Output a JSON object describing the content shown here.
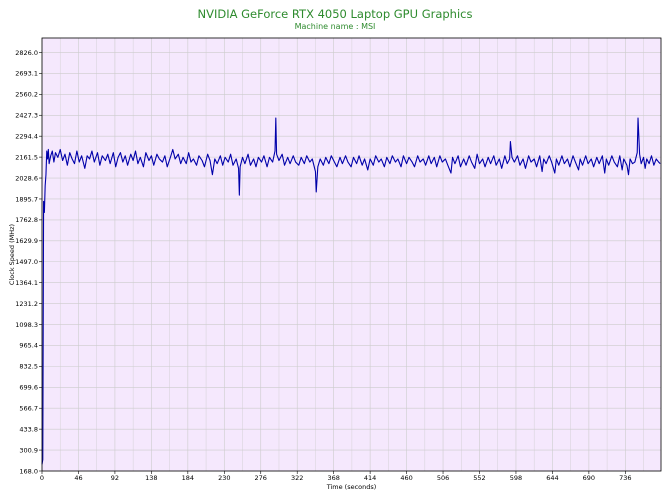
{
  "chart_data": {
    "type": "line",
    "title": "NVIDIA GeForce RTX 4050 Laptop GPU Graphics",
    "subtitle": "Machine name : MSI",
    "xlabel": "Time (seconds)",
    "ylabel": "Clock Speed (MHz)",
    "xlim": [
      0,
      781
    ],
    "ylim": [
      168,
      2918
    ],
    "grid": true,
    "x_ticks": [
      0,
      46,
      92,
      138,
      184,
      230,
      276,
      322,
      368,
      414,
      460,
      506,
      552,
      598,
      644,
      690,
      736
    ],
    "y_ticks": [
      168.0,
      300.9,
      433.8,
      566.7,
      699.6,
      832.5,
      965.4,
      1098.3,
      1231.2,
      1364.1,
      1497.0,
      1629.9,
      1762.8,
      1895.7,
      2028.6,
      2161.5,
      2294.4,
      2427.3,
      2560.2,
      2693.1,
      2826.0
    ],
    "series": [
      {
        "color": "#0000aa",
        "points": [
          [
            0,
            210
          ],
          [
            1,
            240
          ],
          [
            2,
            1880
          ],
          [
            3,
            1810
          ],
          [
            4,
            1980
          ],
          [
            5,
            2050
          ],
          [
            6,
            2200
          ],
          [
            7,
            2150
          ],
          [
            8,
            2210
          ],
          [
            9,
            2120
          ],
          [
            11,
            2170
          ],
          [
            13,
            2200
          ],
          [
            15,
            2130
          ],
          [
            17,
            2190
          ],
          [
            20,
            2160
          ],
          [
            23,
            2210
          ],
          [
            26,
            2140
          ],
          [
            29,
            2180
          ],
          [
            32,
            2110
          ],
          [
            35,
            2190
          ],
          [
            38,
            2150
          ],
          [
            41,
            2120
          ],
          [
            44,
            2200
          ],
          [
            47,
            2130
          ],
          [
            50,
            2170
          ],
          [
            54,
            2090
          ],
          [
            57,
            2170
          ],
          [
            60,
            2150
          ],
          [
            63,
            2200
          ],
          [
            66,
            2130
          ],
          [
            70,
            2190
          ],
          [
            73,
            2110
          ],
          [
            76,
            2170
          ],
          [
            80,
            2140
          ],
          [
            83,
            2180
          ],
          [
            86,
            2120
          ],
          [
            90,
            2190
          ],
          [
            93,
            2100
          ],
          [
            96,
            2160
          ],
          [
            99,
            2190
          ],
          [
            102,
            2130
          ],
          [
            105,
            2170
          ],
          [
            108,
            2110
          ],
          [
            112,
            2180
          ],
          [
            115,
            2140
          ],
          [
            118,
            2200
          ],
          [
            121,
            2120
          ],
          [
            124,
            2160
          ],
          [
            128,
            2100
          ],
          [
            131,
            2190
          ],
          [
            135,
            2140
          ],
          [
            138,
            2170
          ],
          [
            141,
            2110
          ],
          [
            145,
            2180
          ],
          [
            148,
            2150
          ],
          [
            152,
            2130
          ],
          [
            155,
            2170
          ],
          [
            158,
            2100
          ],
          [
            162,
            2160
          ],
          [
            165,
            2210
          ],
          [
            168,
            2150
          ],
          [
            172,
            2180
          ],
          [
            175,
            2120
          ],
          [
            178,
            2160
          ],
          [
            182,
            2120
          ],
          [
            185,
            2190
          ],
          [
            188,
            2130
          ],
          [
            191,
            2150
          ],
          [
            195,
            2110
          ],
          [
            198,
            2170
          ],
          [
            202,
            2140
          ],
          [
            205,
            2100
          ],
          [
            209,
            2180
          ],
          [
            212,
            2140
          ],
          [
            215,
            2050
          ],
          [
            218,
            2150
          ],
          [
            221,
            2120
          ],
          [
            225,
            2170
          ],
          [
            228,
            2110
          ],
          [
            231,
            2160
          ],
          [
            235,
            2130
          ],
          [
            238,
            2180
          ],
          [
            241,
            2110
          ],
          [
            245,
            2150
          ],
          [
            248,
            2090
          ],
          [
            249,
            1920
          ],
          [
            250,
            2100
          ],
          [
            253,
            2160
          ],
          [
            256,
            2120
          ],
          [
            260,
            2180
          ],
          [
            263,
            2110
          ],
          [
            267,
            2150
          ],
          [
            270,
            2100
          ],
          [
            273,
            2160
          ],
          [
            277,
            2130
          ],
          [
            280,
            2170
          ],
          [
            284,
            2100
          ],
          [
            287,
            2160
          ],
          [
            291,
            2130
          ],
          [
            294,
            2200
          ],
          [
            295,
            2410
          ],
          [
            296,
            2180
          ],
          [
            299,
            2140
          ],
          [
            303,
            2180
          ],
          [
            306,
            2110
          ],
          [
            310,
            2160
          ],
          [
            313,
            2120
          ],
          [
            317,
            2170
          ],
          [
            320,
            2130
          ],
          [
            324,
            2110
          ],
          [
            327,
            2160
          ],
          [
            331,
            2120
          ],
          [
            334,
            2170
          ],
          [
            338,
            2130
          ],
          [
            341,
            2150
          ],
          [
            345,
            2070
          ],
          [
            346,
            1940
          ],
          [
            348,
            2100
          ],
          [
            351,
            2150
          ],
          [
            355,
            2110
          ],
          [
            358,
            2160
          ],
          [
            362,
            2120
          ],
          [
            365,
            2170
          ],
          [
            369,
            2130
          ],
          [
            372,
            2100
          ],
          [
            376,
            2160
          ],
          [
            379,
            2120
          ],
          [
            383,
            2170
          ],
          [
            386,
            2130
          ],
          [
            390,
            2100
          ],
          [
            393,
            2160
          ],
          [
            397,
            2120
          ],
          [
            400,
            2170
          ],
          [
            404,
            2110
          ],
          [
            407,
            2150
          ],
          [
            411,
            2080
          ],
          [
            414,
            2150
          ],
          [
            418,
            2110
          ],
          [
            421,
            2170
          ],
          [
            425,
            2130
          ],
          [
            428,
            2150
          ],
          [
            432,
            2100
          ],
          [
            435,
            2160
          ],
          [
            439,
            2120
          ],
          [
            442,
            2170
          ],
          [
            446,
            2130
          ],
          [
            449,
            2150
          ],
          [
            453,
            2100
          ],
          [
            456,
            2170
          ],
          [
            460,
            2120
          ],
          [
            463,
            2160
          ],
          [
            467,
            2130
          ],
          [
            470,
            2100
          ],
          [
            474,
            2170
          ],
          [
            477,
            2130
          ],
          [
            481,
            2150
          ],
          [
            484,
            2110
          ],
          [
            488,
            2170
          ],
          [
            491,
            2120
          ],
          [
            495,
            2160
          ],
          [
            498,
            2100
          ],
          [
            502,
            2170
          ],
          [
            505,
            2130
          ],
          [
            509,
            2150
          ],
          [
            512,
            2110
          ],
          [
            516,
            2060
          ],
          [
            518,
            2160
          ],
          [
            521,
            2120
          ],
          [
            525,
            2170
          ],
          [
            528,
            2100
          ],
          [
            532,
            2150
          ],
          [
            535,
            2110
          ],
          [
            539,
            2170
          ],
          [
            542,
            2130
          ],
          [
            546,
            2090
          ],
          [
            549,
            2180
          ],
          [
            552,
            2120
          ],
          [
            556,
            2150
          ],
          [
            559,
            2100
          ],
          [
            563,
            2160
          ],
          [
            566,
            2120
          ],
          [
            570,
            2170
          ],
          [
            573,
            2110
          ],
          [
            577,
            2150
          ],
          [
            580,
            2090
          ],
          [
            584,
            2170
          ],
          [
            587,
            2120
          ],
          [
            590,
            2150
          ],
          [
            591,
            2260
          ],
          [
            593,
            2160
          ],
          [
            596,
            2130
          ],
          [
            600,
            2170
          ],
          [
            603,
            2110
          ],
          [
            607,
            2150
          ],
          [
            610,
            2090
          ],
          [
            614,
            2170
          ],
          [
            617,
            2130
          ],
          [
            621,
            2150
          ],
          [
            624,
            2100
          ],
          [
            628,
            2170
          ],
          [
            631,
            2070
          ],
          [
            633,
            2150
          ],
          [
            636,
            2120
          ],
          [
            640,
            2170
          ],
          [
            643,
            2130
          ],
          [
            647,
            2060
          ],
          [
            649,
            2150
          ],
          [
            652,
            2110
          ],
          [
            656,
            2170
          ],
          [
            659,
            2120
          ],
          [
            663,
            2150
          ],
          [
            666,
            2100
          ],
          [
            670,
            2170
          ],
          [
            673,
            2130
          ],
          [
            677,
            2080
          ],
          [
            679,
            2150
          ],
          [
            682,
            2110
          ],
          [
            686,
            2170
          ],
          [
            689,
            2120
          ],
          [
            693,
            2150
          ],
          [
            696,
            2100
          ],
          [
            700,
            2160
          ],
          [
            703,
            2120
          ],
          [
            707,
            2170
          ],
          [
            710,
            2060
          ],
          [
            712,
            2150
          ],
          [
            715,
            2110
          ],
          [
            719,
            2170
          ],
          [
            722,
            2130
          ],
          [
            726,
            2100
          ],
          [
            729,
            2170
          ],
          [
            732,
            2080
          ],
          [
            734,
            2150
          ],
          [
            738,
            2110
          ],
          [
            740,
            2050
          ],
          [
            742,
            2150
          ],
          [
            745,
            2120
          ],
          [
            748,
            2130
          ],
          [
            751,
            2190
          ],
          [
            752,
            2410
          ],
          [
            754,
            2180
          ],
          [
            756,
            2120
          ],
          [
            759,
            2160
          ],
          [
            761,
            2090
          ],
          [
            763,
            2150
          ],
          [
            766,
            2120
          ],
          [
            769,
            2170
          ],
          [
            772,
            2110
          ],
          [
            775,
            2150
          ],
          [
            778,
            2130
          ],
          [
            780,
            2120
          ]
        ]
      }
    ]
  },
  "colors": {
    "plot_background": "#f5e8fd",
    "grid": "#cccccc",
    "line": "#0000aa",
    "title": "#2e8b2e"
  }
}
